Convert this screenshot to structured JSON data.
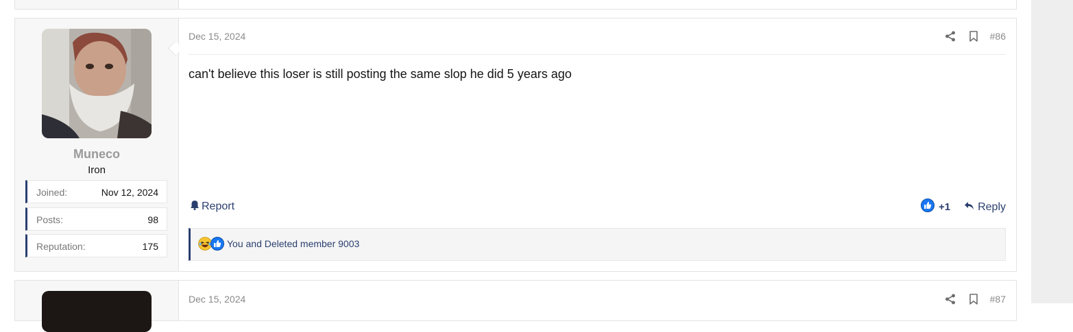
{
  "post": {
    "date": "Dec 15, 2024",
    "number": "#86",
    "body": "can't believe this loser is still posting the same slop he did 5 years ago",
    "user": {
      "name": "Muneco",
      "title": "Iron",
      "stats": [
        {
          "label": "Joined:",
          "value": "Nov 12, 2024"
        },
        {
          "label": "Posts:",
          "value": "98"
        },
        {
          "label": "Reputation:",
          "value": "175"
        }
      ]
    },
    "actions": {
      "report_label": "Report",
      "reaction_count": "+1",
      "reply_label": "Reply"
    },
    "reactions": {
      "summary": "You and Deleted member 9003",
      "icons": [
        "laughing-emoji-icon",
        "like-icon"
      ]
    }
  },
  "next_post": {
    "date": "Dec 15, 2024",
    "number": "#87"
  },
  "colors": {
    "accent": "#2a3e6e",
    "like_blue": "#1877f2",
    "muted_text": "#8a8a8a"
  }
}
